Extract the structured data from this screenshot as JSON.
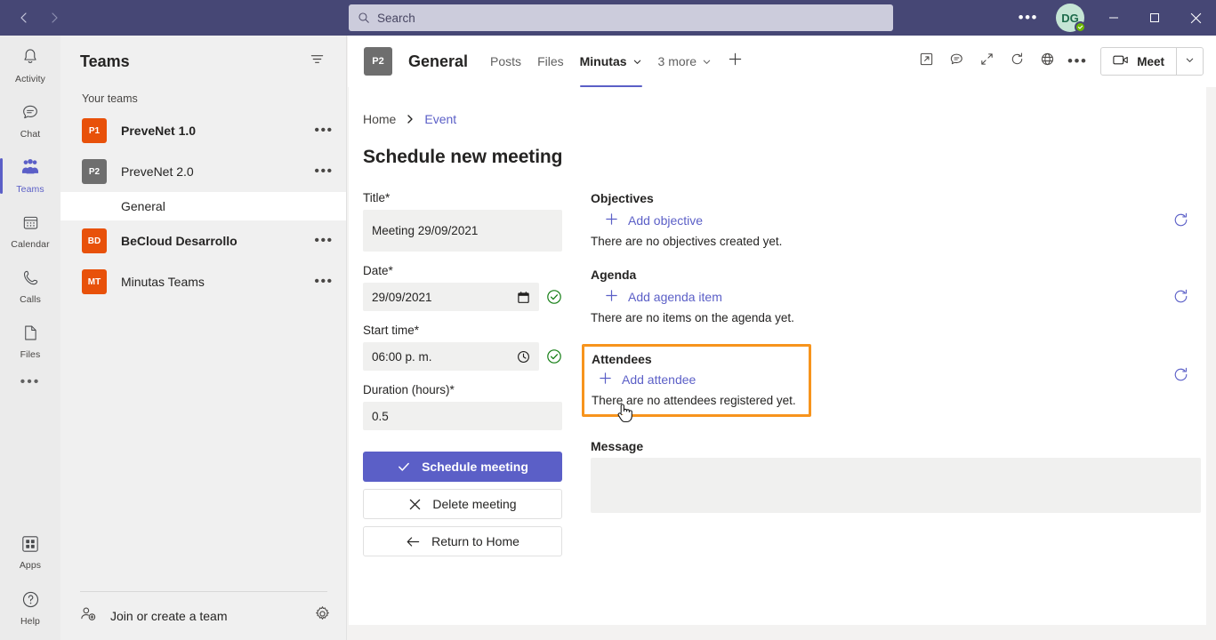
{
  "titlebar": {
    "back_icon": "chevron-left-icon",
    "forward_icon": "chevron-right-icon",
    "search_placeholder": "Search",
    "search_value": "",
    "more_label": "•••",
    "avatar_initials": "DG",
    "presence": "available",
    "minimize_label": "Minimize",
    "maximize_label": "Maximize",
    "close_label": "Close"
  },
  "rail": {
    "items": [
      {
        "label": "Activity",
        "icon": "bell-icon",
        "active": false
      },
      {
        "label": "Chat",
        "icon": "chat-icon",
        "active": false
      },
      {
        "label": "Teams",
        "icon": "teams-icon",
        "active": true
      },
      {
        "label": "Calendar",
        "icon": "calendar-icon",
        "active": false
      },
      {
        "label": "Calls",
        "icon": "phone-icon",
        "active": false
      },
      {
        "label": "Files",
        "icon": "file-icon",
        "active": false
      }
    ],
    "more_label": "•••",
    "bottom": [
      {
        "label": "Apps",
        "icon": "apps-icon"
      },
      {
        "label": "Help",
        "icon": "help-icon"
      }
    ]
  },
  "teams_pane": {
    "title": "Teams",
    "filter_icon": "filter-icon",
    "section_label": "Your teams",
    "teams": [
      {
        "initials": "P1",
        "name": "PreveNet 1.0",
        "color": "#e8510a",
        "bold": true,
        "more": "•••"
      },
      {
        "initials": "P2",
        "name": "PreveNet 2.0",
        "color": "#6e6e6e",
        "bold": false,
        "more": "•••"
      },
      {
        "initials": "BD",
        "name": "BeCloud Desarrollo",
        "color": "#e8510a",
        "bold": true,
        "more": "•••"
      },
      {
        "initials": "MT",
        "name": "Minutas Teams",
        "color": "#e8510a",
        "bold": false,
        "more": "•••"
      }
    ],
    "channel": {
      "name": "General",
      "selected": true
    },
    "footer": {
      "join_label": "Join or create a team",
      "join_icon": "add-people-icon",
      "settings_icon": "gear-icon"
    }
  },
  "channel_header": {
    "team_initials": "P2",
    "channel_name": "General",
    "tabs": [
      {
        "label": "Posts",
        "active": false,
        "caret": false
      },
      {
        "label": "Files",
        "active": false,
        "caret": false
      },
      {
        "label": "Minutas",
        "active": true,
        "caret": true
      },
      {
        "label": "3 more",
        "active": false,
        "caret": true
      }
    ],
    "add_tab_icon": "plus-icon",
    "actions": [
      {
        "icon": "open-in-new-window-icon"
      },
      {
        "icon": "conversation-icon"
      },
      {
        "icon": "expand-icon"
      },
      {
        "icon": "refresh-icon"
      },
      {
        "icon": "globe-icon"
      },
      {
        "icon": "more-icon",
        "label": "•••"
      }
    ],
    "meet_label": "Meet",
    "meet_icon": "video-camera-icon",
    "meet_caret_icon": "chevron-down-icon"
  },
  "content": {
    "breadcrumb": {
      "home": "Home",
      "separator": "›",
      "current": "Event"
    },
    "page_title": "Schedule new meeting",
    "form": {
      "title": {
        "label": "Title*",
        "value": "Meeting  29/09/2021"
      },
      "date": {
        "label": "Date*",
        "value": "29/09/2021",
        "icon": "calendar-icon",
        "valid_icon": "check-circle-icon"
      },
      "start_time": {
        "label": "Start time*",
        "value": "06:00 p. m.",
        "icon": "clock-icon",
        "valid_icon": "check-circle-icon"
      },
      "duration": {
        "label": "Duration (hours)*",
        "value": "0.5"
      }
    },
    "buttons": {
      "schedule": {
        "label": "Schedule meeting",
        "icon": "check-icon"
      },
      "delete": {
        "label": "Delete meeting",
        "icon": "close-icon"
      },
      "return": {
        "label": "Return to Home",
        "icon": "arrow-left-icon"
      }
    },
    "sections": [
      {
        "title": "Objectives",
        "add_label": "Add objective",
        "add_icon": "plus-icon",
        "empty": "There are no objectives created yet.",
        "refresh_icon": "refresh-icon",
        "highlighted": false
      },
      {
        "title": "Agenda",
        "add_label": "Add agenda item",
        "add_icon": "plus-icon",
        "empty": "There are no items on the agenda yet.",
        "refresh_icon": "refresh-icon",
        "highlighted": false
      },
      {
        "title": "Attendees",
        "add_label": "Add attendee",
        "add_icon": "plus-icon",
        "empty": "There are no attendees registered yet.",
        "refresh_icon": "refresh-icon",
        "highlighted": true
      }
    ],
    "message": {
      "label": "Message",
      "value": ""
    }
  },
  "colors": {
    "brand_purple": "#5b5fc7",
    "titlebar": "#464775",
    "highlight_orange": "#f7941d",
    "valid_green": "#107c10",
    "team_orange": "#e8510a"
  }
}
